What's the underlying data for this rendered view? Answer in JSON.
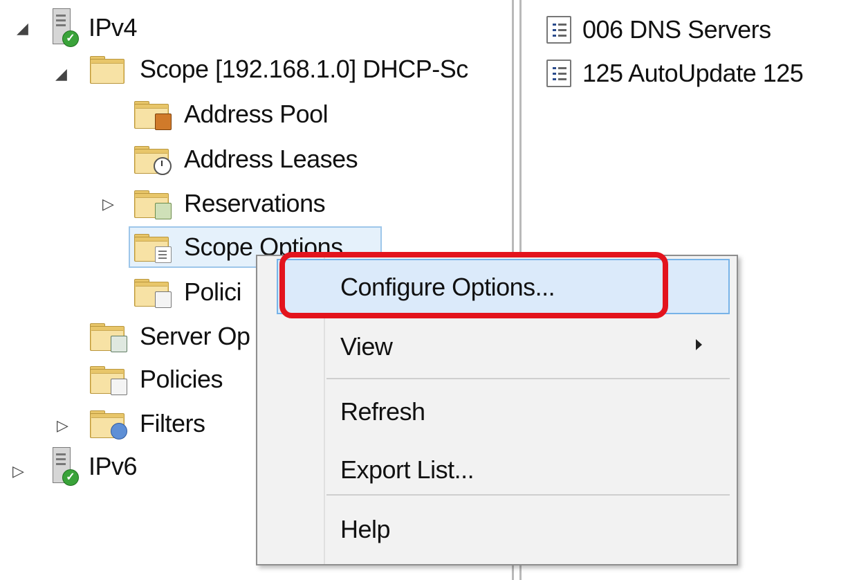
{
  "tree": {
    "ipv4": "IPv4",
    "scope": "Scope [192.168.1.0] DHCP-Sc",
    "address_pool": "Address Pool",
    "address_leases": "Address Leases",
    "reservations": "Reservations",
    "scope_options": "Scope Options",
    "policies_child": "Polici",
    "server_options": "Server Op",
    "policies": "Policies",
    "filters": "Filters",
    "ipv6": "IPv6"
  },
  "right_pane": {
    "options": [
      {
        "label": "006 DNS Servers",
        "icon": "option-doc-icon"
      },
      {
        "label": "125 AutoUpdate 125",
        "icon": "option-doc-icon"
      }
    ]
  },
  "context_menu": {
    "items": [
      "Configure Options...",
      "View",
      "Refresh",
      "Export List...",
      "Help"
    ],
    "highlighted_item": "Configure Options..."
  },
  "colors": {
    "highlight_border": "#e3141d",
    "menu_hover": "#dbeafa",
    "selection": "#e5f1fb"
  }
}
